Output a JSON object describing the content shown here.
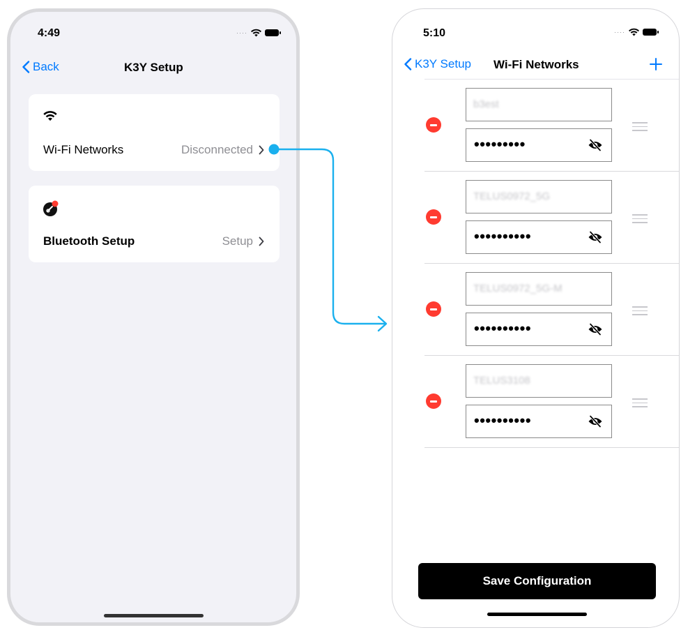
{
  "left_screen": {
    "status_time": "4:49",
    "nav": {
      "back_label": "Back",
      "title": "K3Y Setup"
    },
    "wifi_card": {
      "icon": "wifi-icon",
      "label": "Wi-Fi Networks",
      "value": "Disconnected"
    },
    "bluetooth_card": {
      "icon": "bluetooth-link-icon",
      "label": "Bluetooth Setup",
      "value": "Setup"
    }
  },
  "right_screen": {
    "status_time": "5:10",
    "nav": {
      "back_label": "K3Y Setup",
      "title": "Wi-Fi Networks",
      "add_icon": "plus-icon"
    },
    "networks": [
      {
        "ssid": "b3est",
        "password_masked": "•••••••••"
      },
      {
        "ssid": "TELUS0972_5G",
        "password_masked": "••••••••••"
      },
      {
        "ssid": "TELUS0972_5G-M",
        "password_masked": "••••••••••"
      },
      {
        "ssid": "TELUS3108",
        "password_masked": "••••••••••"
      }
    ],
    "save_label": "Save Configuration"
  },
  "colors": {
    "accent": "#007aff",
    "delete": "#ff3b30",
    "connector": "#1ab0ee",
    "background": "#f2f2f7"
  }
}
